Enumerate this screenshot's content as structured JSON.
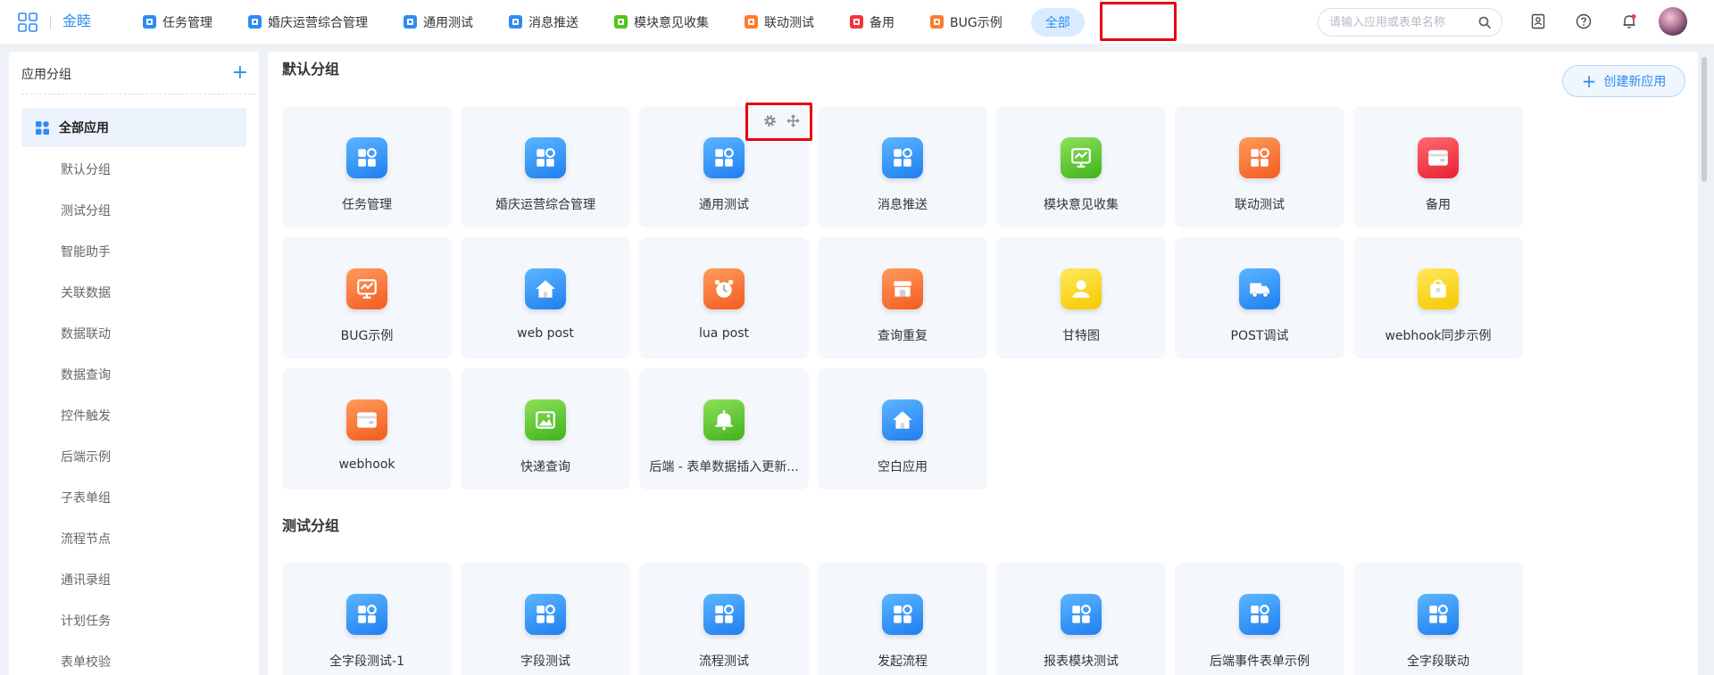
{
  "brand": "金睦",
  "nav": {
    "tabs": [
      {
        "label": "任务管理",
        "color": "#2d8cf0"
      },
      {
        "label": "婚庆运营综合管理",
        "color": "#2d8cf0"
      },
      {
        "label": "通用测试",
        "color": "#2d8cf0"
      },
      {
        "label": "消息推送",
        "color": "#2d8cf0"
      },
      {
        "label": "模块意见收集",
        "color": "#52c41a"
      },
      {
        "label": "联动测试",
        "color": "#ff7a2e"
      },
      {
        "label": "备用",
        "color": "#f5333f"
      },
      {
        "label": "BUG示例",
        "color": "#ff7a2e"
      }
    ],
    "active_tab": "全部"
  },
  "search": {
    "placeholder": "请输入应用或表单名称"
  },
  "sidebar": {
    "title": "应用分组",
    "add_icon": "plus-icon",
    "active_item": "全部应用",
    "items": [
      "默认分组",
      "测试分组",
      "智能助手",
      "关联数据",
      "数据联动",
      "数据查询",
      "控件触发",
      "后端示例",
      "子表单组",
      "流程节点",
      "通讯录组",
      "计划任务",
      "表单校验"
    ]
  },
  "main": {
    "create_button": "创建新应用",
    "groups": [
      {
        "title": "默认分组",
        "apps": [
          {
            "name": "任务管理",
            "icon": "grid-app-icon",
            "color": "blue"
          },
          {
            "name": "婚庆运营综合管理",
            "icon": "grid-app-icon",
            "color": "blue"
          },
          {
            "name": "通用测试",
            "icon": "grid-app-icon",
            "color": "blue"
          },
          {
            "name": "消息推送",
            "icon": "grid-app-icon",
            "color": "blue"
          },
          {
            "name": "模块意见收集",
            "icon": "chart-board-icon",
            "color": "green"
          },
          {
            "name": "联动测试",
            "icon": "grid-app-icon",
            "color": "orange"
          },
          {
            "name": "备用",
            "icon": "wallet-icon",
            "color": "red"
          },
          {
            "name": "BUG示例",
            "icon": "chart-board-icon",
            "color": "orange"
          },
          {
            "name": "web post",
            "icon": "home-icon",
            "color": "blue"
          },
          {
            "name": "lua post",
            "icon": "alarm-clock-icon",
            "color": "orange"
          },
          {
            "name": "查询重复",
            "icon": "store-icon",
            "color": "orange"
          },
          {
            "name": "甘特图",
            "icon": "user-icon",
            "color": "yellow"
          },
          {
            "name": "POST调试",
            "icon": "truck-icon",
            "color": "blue"
          },
          {
            "name": "webhook同步示例",
            "icon": "gift-bag-icon",
            "color": "yellow"
          },
          {
            "name": "webhook",
            "icon": "wallet-icon",
            "color": "orange"
          },
          {
            "name": "快递查询",
            "icon": "image-icon",
            "color": "green"
          },
          {
            "name": "后端 - 表单数据插入更新...",
            "icon": "bell-icon",
            "color": "green"
          },
          {
            "name": "空白应用",
            "icon": "home-icon",
            "color": "blue"
          }
        ]
      },
      {
        "title": "测试分组",
        "apps": [
          {
            "name": "全字段测试-1",
            "icon": "grid-app-icon",
            "color": "blue"
          },
          {
            "name": "字段测试",
            "icon": "grid-app-icon",
            "color": "blue"
          },
          {
            "name": "流程测试",
            "icon": "grid-app-icon",
            "color": "blue"
          },
          {
            "name": "发起流程",
            "icon": "grid-app-icon",
            "color": "blue"
          },
          {
            "name": "报表模块测试",
            "icon": "grid-app-icon",
            "color": "blue"
          },
          {
            "name": "后端事件表单示例",
            "icon": "grid-app-icon",
            "color": "blue"
          },
          {
            "name": "全字段联动",
            "icon": "grid-app-icon",
            "color": "blue"
          }
        ]
      }
    ]
  },
  "colors": {
    "blue": "#2d8cf0",
    "green": "#52c41a",
    "orange": "#ff7a2e",
    "red": "#f5333f",
    "yellow": "#fadb14",
    "highlight": "#e60012"
  }
}
